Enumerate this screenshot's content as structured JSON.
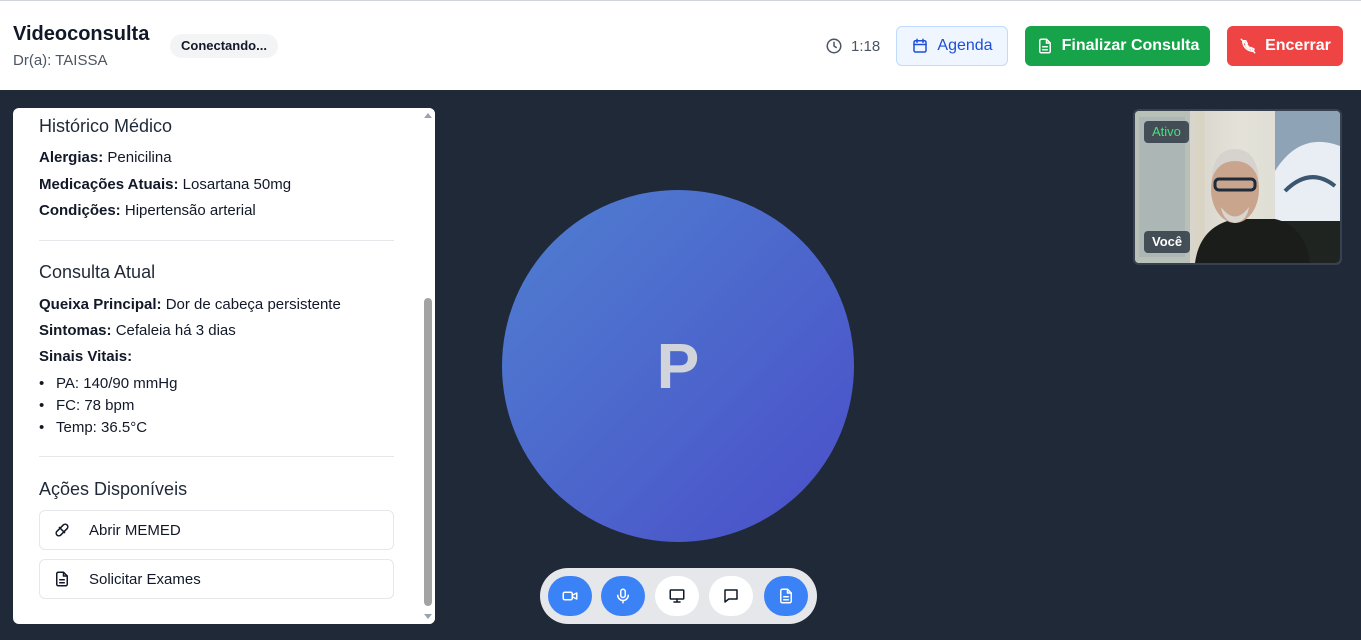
{
  "header": {
    "title": "Videoconsulta",
    "doctor": "Dr(a): TAISSA",
    "status": "Conectando...",
    "timer": "1:18",
    "agenda_label": "Agenda",
    "finalize_label": "Finalizar Consulta",
    "end_label": "Encerrar"
  },
  "history": {
    "title": "Histórico Médico",
    "fields": [
      {
        "label": "Alergias:",
        "value": "Penicilina"
      },
      {
        "label": "Medicações Atuais:",
        "value": "Losartana 50mg"
      },
      {
        "label": "Condições:",
        "value": "Hipertensão arterial"
      }
    ]
  },
  "current": {
    "title": "Consulta Atual",
    "fields": [
      {
        "label": "Queixa Principal:",
        "value": "Dor de cabeça persistente"
      },
      {
        "label": "Sintomas:",
        "value": "Cefaleia há 3 dias"
      }
    ],
    "vitals_label": "Sinais Vitais:",
    "vitals": [
      "PA: 140/90 mmHg",
      "FC: 78 bpm",
      "Temp: 36.5°C"
    ]
  },
  "actions": {
    "title": "Ações Disponíveis",
    "items": [
      "Abrir MEMED",
      "Solicitar Exames"
    ]
  },
  "video": {
    "avatar_initial": "P",
    "self_status": "Ativo",
    "self_label": "Você"
  },
  "colors": {
    "accent_blue": "#3b82f6",
    "success_green": "#16a34a",
    "danger_red": "#ef4444",
    "background": "#1f2937"
  }
}
